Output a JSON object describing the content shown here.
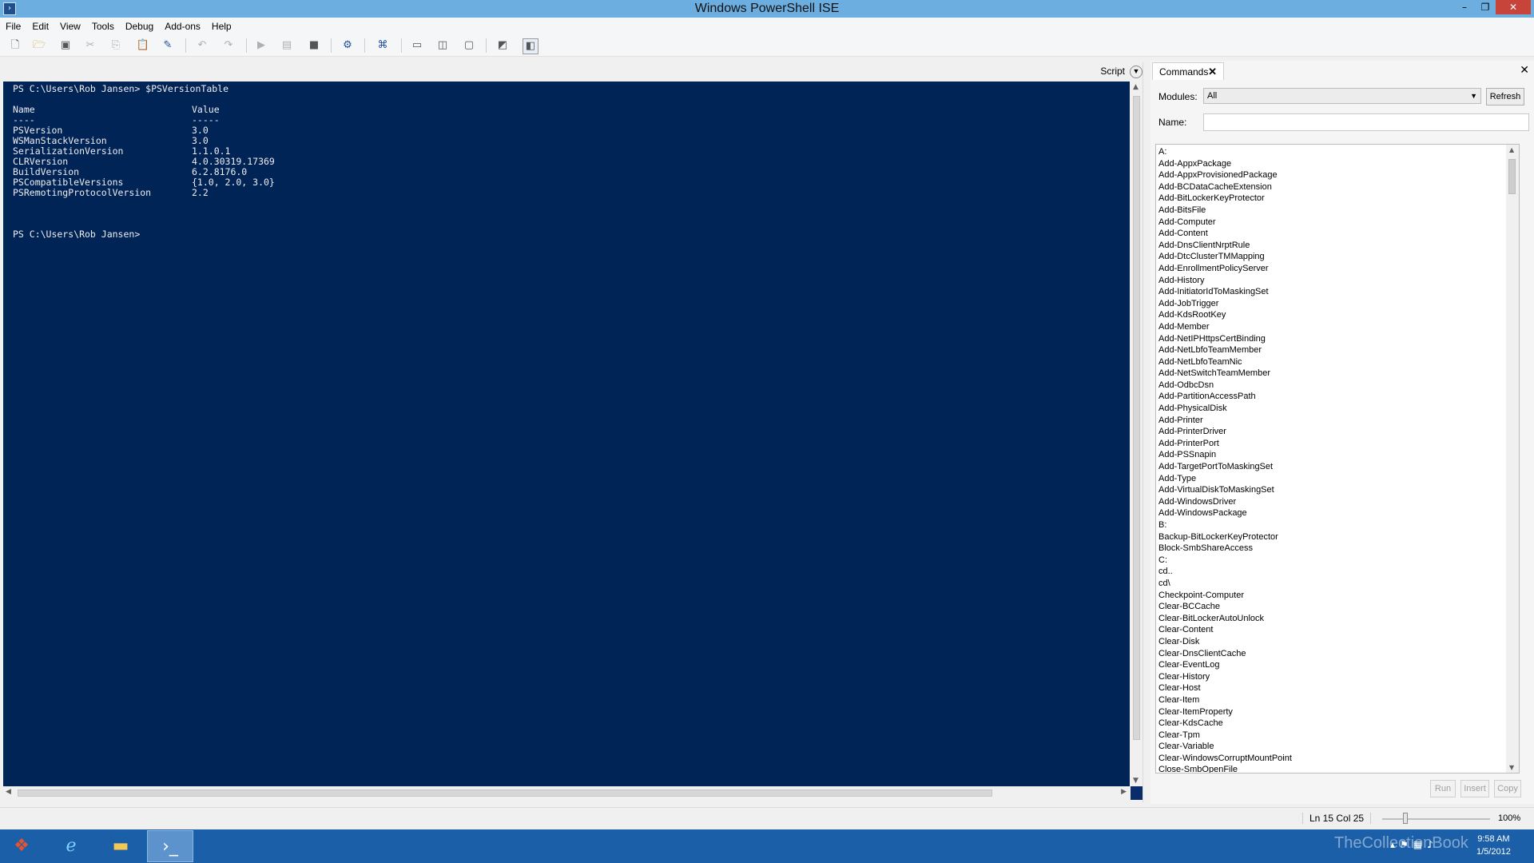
{
  "window": {
    "title": "Windows PowerShell ISE",
    "controls": {
      "minimize": "–",
      "restore": "❐",
      "close": "✕"
    }
  },
  "menu": [
    "File",
    "Edit",
    "View",
    "Tools",
    "Debug",
    "Add-ons",
    "Help"
  ],
  "toolbar_icons": [
    "new-icon",
    "open-icon",
    "save-icon",
    "cut-icon",
    "copy-icon",
    "paste-icon",
    "clear-console-icon",
    "undo-icon",
    "redo-icon",
    "run-icon",
    "run-selection-icon",
    "stop-icon",
    "remote-icon",
    "powershell-icon",
    "layout-top-icon",
    "layout-right-icon",
    "layout-max-icon",
    "script-pane-icon",
    "command-addon-icon"
  ],
  "script_toggle": {
    "label": "Script",
    "icon": "chevron-down-icon"
  },
  "console": {
    "prompt1": "PS C:\\Users\\Rob Jansen> $PSVersionTable",
    "header_name": "Name",
    "header_value": "Value",
    "sep_name": "----",
    "sep_value": "-----",
    "rows": [
      {
        "name": "PSVersion",
        "value": "3.0"
      },
      {
        "name": "WSManStackVersion",
        "value": "3.0"
      },
      {
        "name": "SerializationVersion",
        "value": "1.1.0.1"
      },
      {
        "name": "CLRVersion",
        "value": "4.0.30319.17369"
      },
      {
        "name": "BuildVersion",
        "value": "6.2.8176.0"
      },
      {
        "name": "PSCompatibleVersions",
        "value": "{1.0, 2.0, 3.0}"
      },
      {
        "name": "PSRemotingProtocolVersion",
        "value": "2.2"
      }
    ],
    "prompt2": "PS C:\\Users\\Rob Jansen>"
  },
  "commands_pane": {
    "tab_label": "Commands",
    "modules_label": "Modules:",
    "modules_value": "All",
    "refresh_label": "Refresh",
    "name_label": "Name:",
    "name_value": "",
    "items": [
      "A:",
      "Add-AppxPackage",
      "Add-AppxProvisionedPackage",
      "Add-BCDataCacheExtension",
      "Add-BitLockerKeyProtector",
      "Add-BitsFile",
      "Add-Computer",
      "Add-Content",
      "Add-DnsClientNrptRule",
      "Add-DtcClusterTMMapping",
      "Add-EnrollmentPolicyServer",
      "Add-History",
      "Add-InitiatorIdToMaskingSet",
      "Add-JobTrigger",
      "Add-KdsRootKey",
      "Add-Member",
      "Add-NetIPHttpsCertBinding",
      "Add-NetLbfoTeamMember",
      "Add-NetLbfoTeamNic",
      "Add-NetSwitchTeamMember",
      "Add-OdbcDsn",
      "Add-PartitionAccessPath",
      "Add-PhysicalDisk",
      "Add-Printer",
      "Add-PrinterDriver",
      "Add-PrinterPort",
      "Add-PSSnapin",
      "Add-TargetPortToMaskingSet",
      "Add-Type",
      "Add-VirtualDiskToMaskingSet",
      "Add-WindowsDriver",
      "Add-WindowsPackage",
      "B:",
      "Backup-BitLockerKeyProtector",
      "Block-SmbShareAccess",
      "C:",
      "cd..",
      "cd\\",
      "Checkpoint-Computer",
      "Clear-BCCache",
      "Clear-BitLockerAutoUnlock",
      "Clear-Content",
      "Clear-Disk",
      "Clear-DnsClientCache",
      "Clear-EventLog",
      "Clear-History",
      "Clear-Host",
      "Clear-Item",
      "Clear-ItemProperty",
      "Clear-KdsCache",
      "Clear-Tpm",
      "Clear-Variable",
      "Clear-WindowsCorruptMountPoint",
      "Close-SmbOpenFile"
    ],
    "run_label": "Run",
    "insert_label": "Insert",
    "copy_label": "Copy"
  },
  "status": {
    "position": "Ln 15  Col 25",
    "zoom_percent": "100%",
    "zoom_level": 0.1
  },
  "taskbar": {
    "watermark": "TheCollectionBook",
    "time": "9:58 AM",
    "date": "1/5/2012"
  }
}
